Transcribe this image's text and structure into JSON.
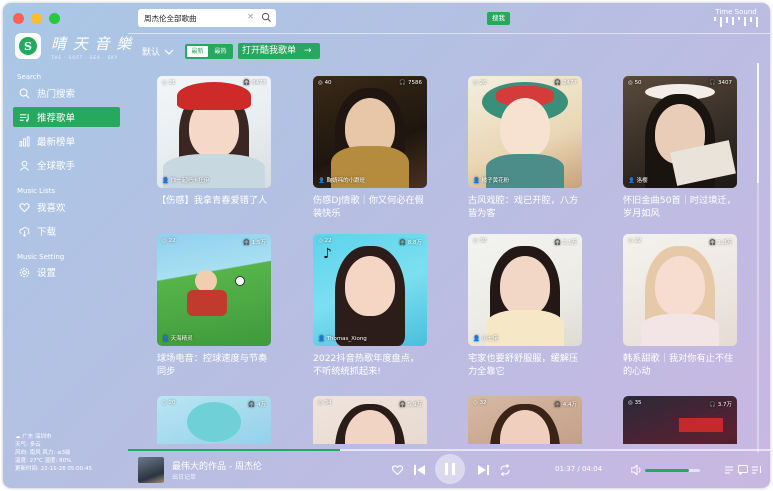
{
  "window": {
    "controls": [
      "close",
      "minimize",
      "maximize"
    ]
  },
  "brand": {
    "logo_letter": "S",
    "name": "晴 天 音 樂",
    "tagline": "THE · SOFT · SEA · SKY"
  },
  "sidebar": {
    "section_search": "Search",
    "section_lists": "Music Lists",
    "section_setting": "Music Setting",
    "items": [
      {
        "label": "热门搜索",
        "icon": "search-icon"
      },
      {
        "label": "推荐歌单",
        "icon": "playlist-icon",
        "active": true
      },
      {
        "label": "最新榜单",
        "icon": "chart-icon"
      },
      {
        "label": "全球歌手",
        "icon": "singer-icon"
      },
      {
        "label": "我喜欢",
        "icon": "heart-icon"
      },
      {
        "label": "下载",
        "icon": "download-icon"
      },
      {
        "label": "设置",
        "icon": "gear-icon"
      }
    ]
  },
  "weather": {
    "location": "广东 深圳市",
    "weather": "天气: 多云",
    "wind": "风向: 南风  风力: ≤3级",
    "temp": "温度: 27℃  湿度: 80%",
    "updated": "更新时间: 22-11-28 05:00:45"
  },
  "search": {
    "value": "周杰伦全部歌曲",
    "button": "搜我"
  },
  "brand_right": {
    "text": "Time Sound"
  },
  "toolbar": {
    "sort_label": "默认",
    "seg_new": "最新",
    "seg_hot": "最热",
    "open_label": "打开酷我歌单",
    "open_arrow": "→"
  },
  "cards": [
    {
      "plays": "21",
      "listens": "8473",
      "author": "你一起吧卡狂伊",
      "title": "【伤感】我拿青春爱错了人"
    },
    {
      "plays": "40",
      "listens": "7586",
      "author": "鞠婧祎的小跟班",
      "title": "伤感DJ情歌｜你又何必在假装快乐"
    },
    {
      "plays": "26",
      "listens": "2477",
      "author": "橘子黄花粉",
      "title": "古风戏腔：戏已开腔，八方皆为客"
    },
    {
      "plays": "50",
      "listens": "3407",
      "author": "洛樱",
      "title": "怀旧金曲50首｜时过境迁，岁月如风"
    },
    {
      "plays": "22",
      "listens": "1.5万",
      "author": "天海精灵",
      "title": "球场电音：控球速度与节奏同步"
    },
    {
      "plays": "22",
      "listens": "8.8万",
      "author": "Thomas_Xiong",
      "title": "2022抖音热歌年度盘点，不听统统抓起来!"
    },
    {
      "plays": "30",
      "listens": "2.1万",
      "author": "小七佬",
      "title": "宅家也要舒舒服服，缓解压力全靠它"
    },
    {
      "plays": "22",
      "listens": "1.8万",
      "author": "",
      "title": "韩系甜歌｜我对你有止不住的心动"
    },
    {
      "plays": "20",
      "listens": "4万",
      "author": "",
      "title": ""
    },
    {
      "plays": "34",
      "listens": "5.9万",
      "author": "",
      "title": ""
    },
    {
      "plays": "32",
      "listens": "4.4万",
      "author": "",
      "title": ""
    },
    {
      "plays": "35",
      "listens": "3.7万",
      "author": "",
      "title": ""
    }
  ],
  "player": {
    "song": "最伟大的作品 - 周杰伦",
    "album": "出日记单",
    "time": "01:37 / 04:04",
    "progress": 0.33,
    "volume": 0.8
  },
  "colors": {
    "accent": "#27a85f",
    "text": "#ffffff"
  }
}
